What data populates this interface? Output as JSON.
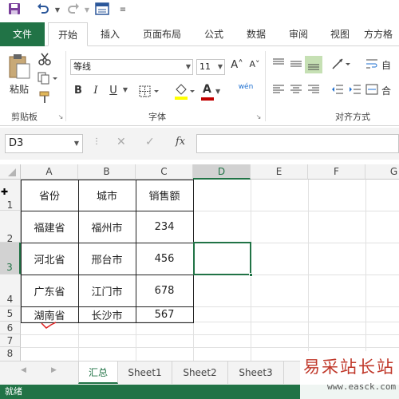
{
  "qat": {
    "save_icon": "save-icon",
    "undo_icon": "undo-icon",
    "redo_icon": "redo-icon",
    "form_icon": "form-icon"
  },
  "tabs": [
    "文件",
    "开始",
    "插入",
    "页面布局",
    "公式",
    "数据",
    "审阅",
    "视图",
    "方方格"
  ],
  "ribbon": {
    "paste_label": "粘贴",
    "clipboard_label": "剪贴板",
    "font_name": "等线",
    "font_size": "11",
    "font_group_label": "字体",
    "align_group_label": "对齐方式",
    "bold": "B",
    "italic": "I",
    "underline": "U",
    "font_color_letter": "A",
    "phonetic": "wén",
    "grow_font": "A˄",
    "shrink_font": "A˅",
    "wrap_label": "自",
    "merge_label": "合"
  },
  "formula_bar": {
    "name_box": "D3",
    "fx": "fx",
    "cancel": "✕",
    "enter": "✓",
    "content": ""
  },
  "columns": [
    "A",
    "B",
    "C",
    "D",
    "E",
    "F",
    "G"
  ],
  "rows": [
    "1",
    "2",
    "3",
    "4",
    "5",
    "6",
    "7",
    "8"
  ],
  "table": {
    "header": [
      "省份",
      "城市",
      "销售额"
    ],
    "rows": [
      [
        "福建省",
        "福州市",
        "234"
      ],
      [
        "河北省",
        "邢台市",
        "456"
      ],
      [
        "广东省",
        "江门市",
        "678"
      ],
      [
        "湖南省",
        "长沙市",
        "567"
      ]
    ]
  },
  "selected_cell": "D3",
  "sheets": [
    "汇总",
    "Sheet1",
    "Sheet2",
    "Sheet3"
  ],
  "status": "就绪",
  "watermark": {
    "main": "易采站长站",
    "sub": "www.easck.com"
  },
  "colors": {
    "accent": "#217346",
    "font_color": "#c00000",
    "highlight": "#ffff00"
  }
}
